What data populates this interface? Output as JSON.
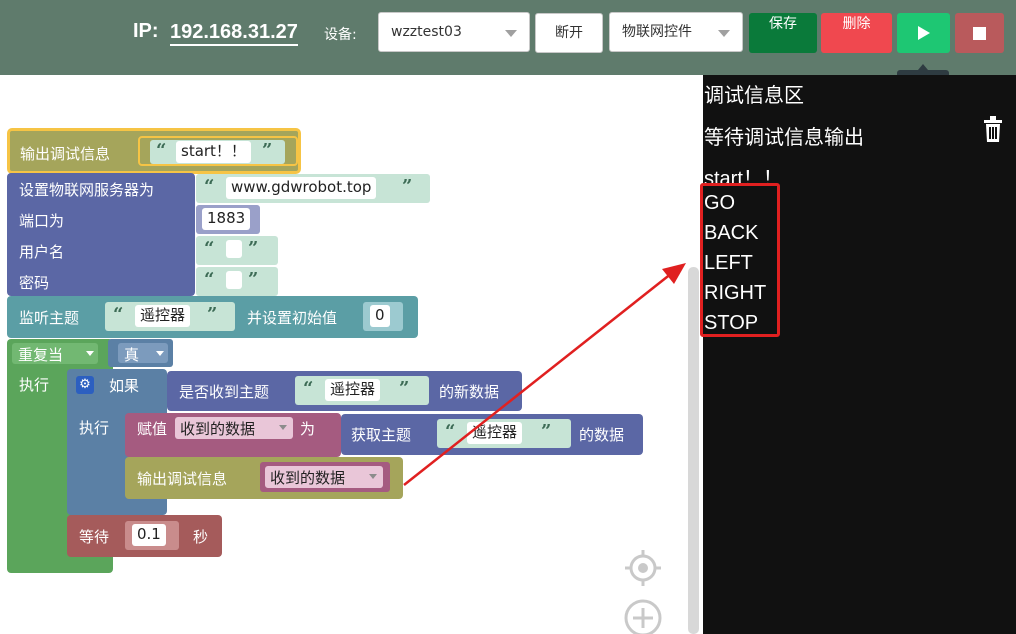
{
  "header": {
    "ip_label": "IP:",
    "ip_value": "192.168.31.27",
    "device_label": "设备:",
    "device_select": "wzztest03",
    "disconnect_label": "断开",
    "control_select": "物联网控件",
    "save_label": "保存",
    "delete_label": "删除",
    "run_tooltip": "运行"
  },
  "blocks": {
    "debug_output_label": "输出调试信息",
    "debug_output_value": "start！！",
    "set_server_label": "设置物联网服务器为",
    "server_value": "www.gdwrobot.top",
    "port_label": "端口为",
    "port_value": "1883",
    "username_label": "用户名",
    "username_value": "",
    "password_label": "密码",
    "password_value": "",
    "subscribe_label": "监听主题",
    "subscribe_topic": "遥控器",
    "init_value_label": "并设置初始值",
    "init_value": "0",
    "repeat_label": "重复当",
    "repeat_condition": "真",
    "do_label": "执行",
    "if_label": "如果",
    "received_label": "是否收到主题",
    "received_topic": "遥控器",
    "new_data_label": "的新数据",
    "inner_do_label": "执行",
    "assign_label": "赋值",
    "assign_var": "收到的数据",
    "as_label": "为",
    "get_topic_label": "获取主题",
    "get_topic_value": "遥控器",
    "get_data_label": "的数据",
    "output_label": "输出调试信息",
    "output_var": "收到的数据",
    "wait_label": "等待",
    "wait_value": "0.1",
    "seconds_label": "秒"
  },
  "debug_panel": {
    "title": "调试信息区",
    "status": "等待调试信息输出",
    "lines": [
      "start！！",
      "GO",
      "BACK",
      "LEFT",
      "RIGHT",
      "STOP"
    ]
  },
  "colors": {
    "header_bg": "#5f7b6c",
    "save_bg": "#0a7a3a",
    "delete_bg": "#f0484f",
    "run_bg": "#1ec773",
    "stop_bg": "#b95a5c",
    "debug_bg": "#111111",
    "highlight": "#e02020",
    "block_iot": "#5b67a5",
    "block_loop": "#5ba55b",
    "block_if": "#5b80a5",
    "block_var": "#a55b80",
    "block_text": "#a5a55b",
    "block_topic": "#5b9ea5",
    "block_wait": "#a55b5b"
  }
}
